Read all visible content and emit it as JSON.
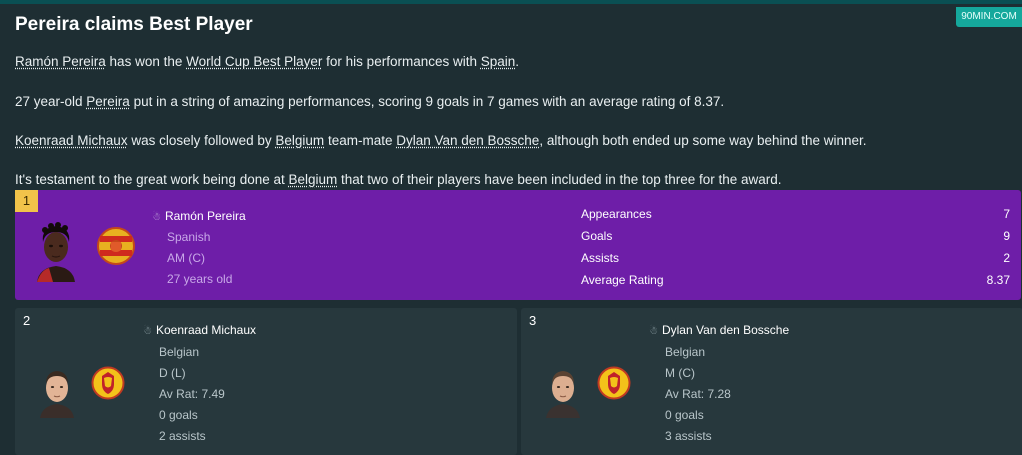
{
  "watermark": "90MIN.COM",
  "article": {
    "title": "Pereira claims Best Player",
    "p1": {
      "link1": "Ramón Pereira",
      "t1": " has won the ",
      "link2": "World Cup Best Player",
      "t2": " for his performances with ",
      "link3": "Spain",
      "t3": "."
    },
    "p2": {
      "t1": "27 year-old ",
      "link1": "Pereira",
      "t2": " put in a string of amazing performances, scoring 9 goals in 7 games with an average rating of 8.37."
    },
    "p3": {
      "link1": "Koenraad Michaux",
      "t1": " was closely followed by ",
      "link2": "Belgium",
      "t2": " team-mate ",
      "link3": "Dylan Van den Bossche",
      "t3": ", although both ended up some way behind the winner."
    },
    "p4": {
      "t1": "It's testament to the great work being done at ",
      "link1": "Belgium",
      "t2": " that two of their players have been included in the top three for the award."
    }
  },
  "winner": {
    "rank": "1",
    "name": "Ramón Pereira",
    "nationality": "Spanish",
    "position": "AM (C)",
    "age": "27 years old",
    "stats": [
      {
        "label": "Appearances",
        "value": "7"
      },
      {
        "label": "Goals",
        "value": "9"
      },
      {
        "label": "Assists",
        "value": "2"
      },
      {
        "label": "Average Rating",
        "value": "8.37"
      }
    ]
  },
  "runners": [
    {
      "rank": "2",
      "name": "Koenraad Michaux",
      "nationality": "Belgian",
      "position": "D (L)",
      "rating": "Av Rat: 7.49",
      "goals": "0 goals",
      "assists": "2 assists"
    },
    {
      "rank": "3",
      "name": "Dylan Van den Bossche",
      "nationality": "Belgian",
      "position": "M (C)",
      "rating": "Av Rat: 7.28",
      "goals": "0 goals",
      "assists": "3 assists"
    }
  ],
  "colors": {
    "background": "#1e2e33",
    "winner_card": "#6e1ea8",
    "runner_card": "#27383d",
    "rank_badge": "#f2c34a",
    "watermark": "#15a89c"
  },
  "icons": {
    "player": "person-icon",
    "spain_flag": "spain-flag-icon",
    "belgium_flag": "belgium-flag-icon"
  }
}
